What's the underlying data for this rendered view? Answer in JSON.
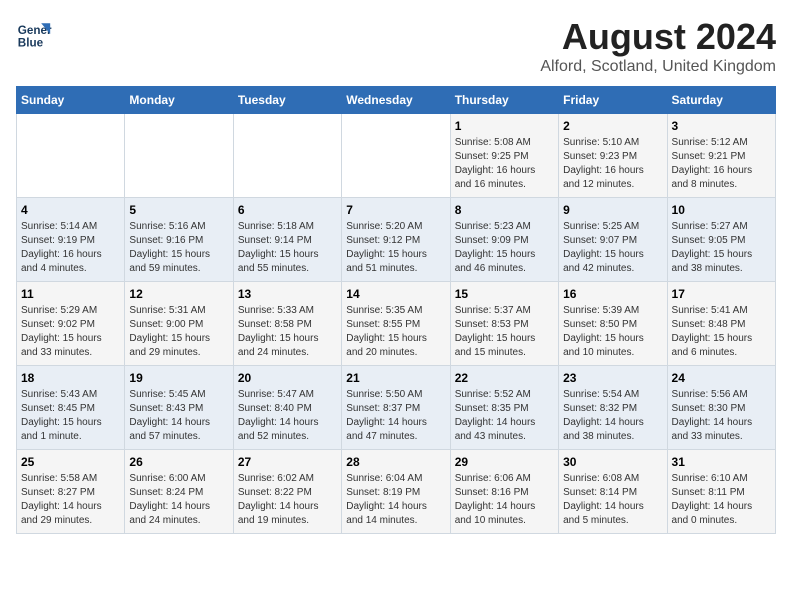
{
  "header": {
    "logo_line1": "General",
    "logo_line2": "Blue",
    "title": "August 2024",
    "subtitle": "Alford, Scotland, United Kingdom"
  },
  "days_of_week": [
    "Sunday",
    "Monday",
    "Tuesday",
    "Wednesday",
    "Thursday",
    "Friday",
    "Saturday"
  ],
  "weeks": [
    [
      {
        "day": "",
        "info": ""
      },
      {
        "day": "",
        "info": ""
      },
      {
        "day": "",
        "info": ""
      },
      {
        "day": "",
        "info": ""
      },
      {
        "day": "1",
        "info": "Sunrise: 5:08 AM\nSunset: 9:25 PM\nDaylight: 16 hours and 16 minutes."
      },
      {
        "day": "2",
        "info": "Sunrise: 5:10 AM\nSunset: 9:23 PM\nDaylight: 16 hours and 12 minutes."
      },
      {
        "day": "3",
        "info": "Sunrise: 5:12 AM\nSunset: 9:21 PM\nDaylight: 16 hours and 8 minutes."
      }
    ],
    [
      {
        "day": "4",
        "info": "Sunrise: 5:14 AM\nSunset: 9:19 PM\nDaylight: 16 hours and 4 minutes."
      },
      {
        "day": "5",
        "info": "Sunrise: 5:16 AM\nSunset: 9:16 PM\nDaylight: 15 hours and 59 minutes."
      },
      {
        "day": "6",
        "info": "Sunrise: 5:18 AM\nSunset: 9:14 PM\nDaylight: 15 hours and 55 minutes."
      },
      {
        "day": "7",
        "info": "Sunrise: 5:20 AM\nSunset: 9:12 PM\nDaylight: 15 hours and 51 minutes."
      },
      {
        "day": "8",
        "info": "Sunrise: 5:23 AM\nSunset: 9:09 PM\nDaylight: 15 hours and 46 minutes."
      },
      {
        "day": "9",
        "info": "Sunrise: 5:25 AM\nSunset: 9:07 PM\nDaylight: 15 hours and 42 minutes."
      },
      {
        "day": "10",
        "info": "Sunrise: 5:27 AM\nSunset: 9:05 PM\nDaylight: 15 hours and 38 minutes."
      }
    ],
    [
      {
        "day": "11",
        "info": "Sunrise: 5:29 AM\nSunset: 9:02 PM\nDaylight: 15 hours and 33 minutes."
      },
      {
        "day": "12",
        "info": "Sunrise: 5:31 AM\nSunset: 9:00 PM\nDaylight: 15 hours and 29 minutes."
      },
      {
        "day": "13",
        "info": "Sunrise: 5:33 AM\nSunset: 8:58 PM\nDaylight: 15 hours and 24 minutes."
      },
      {
        "day": "14",
        "info": "Sunrise: 5:35 AM\nSunset: 8:55 PM\nDaylight: 15 hours and 20 minutes."
      },
      {
        "day": "15",
        "info": "Sunrise: 5:37 AM\nSunset: 8:53 PM\nDaylight: 15 hours and 15 minutes."
      },
      {
        "day": "16",
        "info": "Sunrise: 5:39 AM\nSunset: 8:50 PM\nDaylight: 15 hours and 10 minutes."
      },
      {
        "day": "17",
        "info": "Sunrise: 5:41 AM\nSunset: 8:48 PM\nDaylight: 15 hours and 6 minutes."
      }
    ],
    [
      {
        "day": "18",
        "info": "Sunrise: 5:43 AM\nSunset: 8:45 PM\nDaylight: 15 hours and 1 minute."
      },
      {
        "day": "19",
        "info": "Sunrise: 5:45 AM\nSunset: 8:43 PM\nDaylight: 14 hours and 57 minutes."
      },
      {
        "day": "20",
        "info": "Sunrise: 5:47 AM\nSunset: 8:40 PM\nDaylight: 14 hours and 52 minutes."
      },
      {
        "day": "21",
        "info": "Sunrise: 5:50 AM\nSunset: 8:37 PM\nDaylight: 14 hours and 47 minutes."
      },
      {
        "day": "22",
        "info": "Sunrise: 5:52 AM\nSunset: 8:35 PM\nDaylight: 14 hours and 43 minutes."
      },
      {
        "day": "23",
        "info": "Sunrise: 5:54 AM\nSunset: 8:32 PM\nDaylight: 14 hours and 38 minutes."
      },
      {
        "day": "24",
        "info": "Sunrise: 5:56 AM\nSunset: 8:30 PM\nDaylight: 14 hours and 33 minutes."
      }
    ],
    [
      {
        "day": "25",
        "info": "Sunrise: 5:58 AM\nSunset: 8:27 PM\nDaylight: 14 hours and 29 minutes."
      },
      {
        "day": "26",
        "info": "Sunrise: 6:00 AM\nSunset: 8:24 PM\nDaylight: 14 hours and 24 minutes."
      },
      {
        "day": "27",
        "info": "Sunrise: 6:02 AM\nSunset: 8:22 PM\nDaylight: 14 hours and 19 minutes."
      },
      {
        "day": "28",
        "info": "Sunrise: 6:04 AM\nSunset: 8:19 PM\nDaylight: 14 hours and 14 minutes."
      },
      {
        "day": "29",
        "info": "Sunrise: 6:06 AM\nSunset: 8:16 PM\nDaylight: 14 hours and 10 minutes."
      },
      {
        "day": "30",
        "info": "Sunrise: 6:08 AM\nSunset: 8:14 PM\nDaylight: 14 hours and 5 minutes."
      },
      {
        "day": "31",
        "info": "Sunrise: 6:10 AM\nSunset: 8:11 PM\nDaylight: 14 hours and 0 minutes."
      }
    ]
  ]
}
